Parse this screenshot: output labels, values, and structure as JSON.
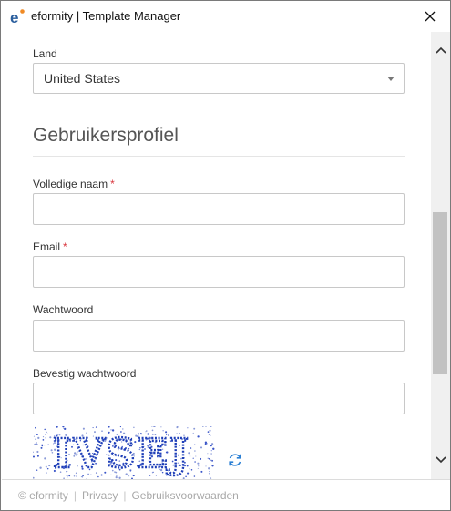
{
  "window": {
    "title": "eformity | Template Manager",
    "icon": "eformity-logo-icon"
  },
  "form": {
    "country": {
      "label": "Land",
      "value": "United States"
    },
    "section_title": "Gebruikersprofiel",
    "full_name": {
      "label": "Volledige naam",
      "required_mark": "*",
      "value": ""
    },
    "email": {
      "label": "Email",
      "required_mark": "*",
      "value": ""
    },
    "password": {
      "label": "Wachtwoord",
      "value": ""
    },
    "confirm_password": {
      "label": "Bevestig wachtwoord",
      "value": ""
    },
    "captcha": {
      "text": "IVSEJ",
      "refresh_icon": "refresh-icon"
    }
  },
  "footer": {
    "copyright": "© eformity",
    "privacy": "Privacy",
    "terms": "Gebruiksvoorwaarden",
    "separator": "|"
  },
  "colors": {
    "required": "#d9363e",
    "captcha_text": "#1f3fb8",
    "refresh_icon": "#2a7fd4",
    "logo_accent": "#f08a24",
    "logo_main": "#2b5f9e"
  }
}
